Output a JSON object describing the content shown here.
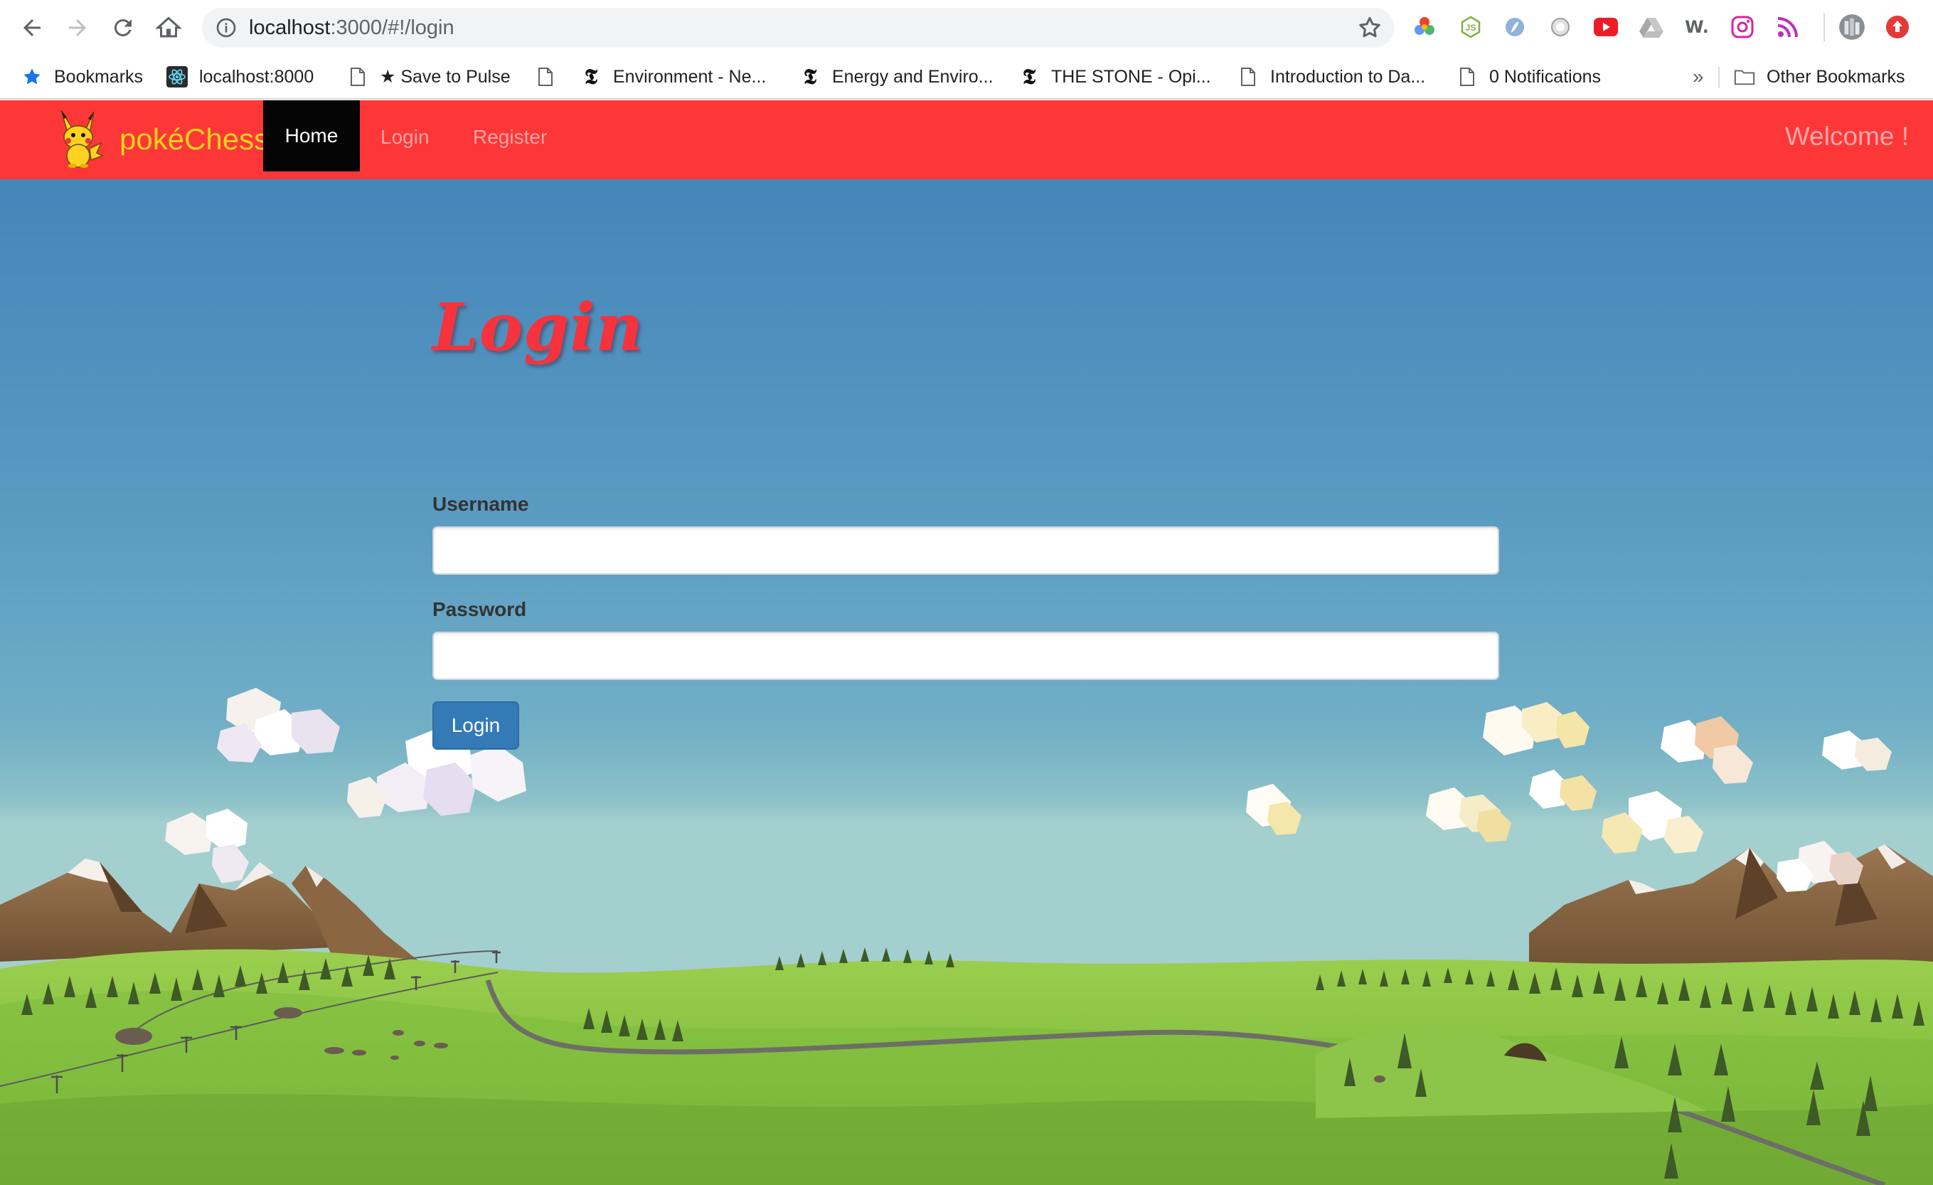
{
  "browser": {
    "url_host": "localhost",
    "url_path": ":3000/#!/login",
    "bookmarks": [
      {
        "label": "Bookmarks",
        "icon": "star-icon"
      },
      {
        "label": "localhost:8000",
        "icon": "react-icon"
      },
      {
        "label": "★ Save to Pulse",
        "icon": "page-icon"
      },
      {
        "label": "",
        "icon": "page-icon"
      },
      {
        "label": "Environment - Ne...",
        "icon": "nyt-icon"
      },
      {
        "label": "Energy and Enviro...",
        "icon": "nyt-icon"
      },
      {
        "label": "THE STONE - Opi...",
        "icon": "nyt-icon"
      },
      {
        "label": "Introduction to Da...",
        "icon": "page-icon"
      },
      {
        "label": "0 Notifications",
        "icon": "page-icon"
      }
    ],
    "overflow_label": "»",
    "other_bookmarks": "Other Bookmarks",
    "extension_text_w": "W."
  },
  "navbar": {
    "brand": "pokéChess",
    "home": "Home",
    "login": "Login",
    "register": "Register",
    "welcome": "Welcome !"
  },
  "form": {
    "heading": "Login",
    "username_label": "Username",
    "username_value": "",
    "password_label": "Password",
    "password_value": "",
    "submit_label": "Login"
  },
  "colors": {
    "navbar": "#fd3737",
    "brand": "#ffd21f",
    "heading": "#f6333d",
    "button": "#337ab7"
  }
}
